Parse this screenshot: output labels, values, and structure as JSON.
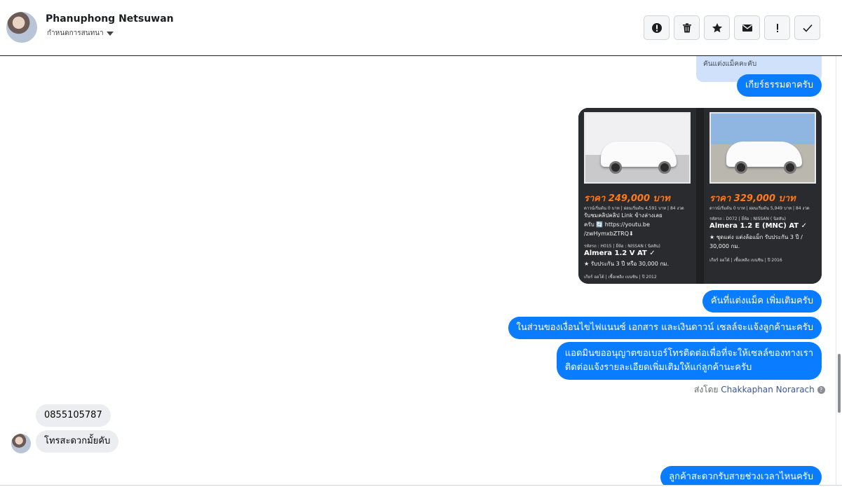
{
  "header": {
    "contact_name": "Phanuphong Netsuwan",
    "subtitle": "กำหนดการสนทนา"
  },
  "toolbar": {
    "buttons": [
      {
        "icon": "alert-circle-icon",
        "label": "Report"
      },
      {
        "icon": "trash-icon",
        "label": "Delete"
      },
      {
        "icon": "star-icon",
        "label": "Star"
      },
      {
        "icon": "envelope-icon",
        "label": "Mark unread"
      },
      {
        "icon": "exclamation-icon",
        "label": "Mark important"
      },
      {
        "icon": "check-icon",
        "label": "Done"
      }
    ]
  },
  "messages": {
    "quoted_reply": "คันแต่งแม็คคะคับ",
    "m1": "เกียร์ธรรมดาครับ",
    "m2": "คันที่แต่งแม็ค เพิ่มเติมครับ",
    "m3": "ในส่วนของเงื่อนไขไฟแนนซ์ เอกสาร และเงินดาวน์ เซลล์จะแจ้งลูกค้านะครับ",
    "m4_line1": "แอดมินขออนุญาตขอเบอร์โทรติดต่อเพื่อที่จะให้เซลล์ของทางเรา",
    "m4_line2": "ติดต่อแจ้งรายละเอียดเพิ่มเติมให้แก่ลูกค้านะครับ",
    "sent_by_prefix": "ส่งโดย",
    "sent_by_name": "Chakkaphan Norarach",
    "in1": "0855105787",
    "in2": "โทรสะดวกมั้ยคับ",
    "m5": "ลูกค้าสะดวกรับสายช่วงเวลาไหนครับ"
  },
  "car_card": {
    "left": {
      "price": "ราคา 249,000 บาท",
      "terms": "ดาวน์เริ่มต้น 0 บาท | ผ่อนเริ่มต้น 4,591 บาท | 84 งวด",
      "clip_line": "รับชมคลิปคลิป Link ข้างล่างเลย",
      "clip_line2": "ครับ 🔄 https://youtu.be",
      "clip_line3": "/zwHymxbZTRQ⬇",
      "code": "รหัสรถ : H015 | ยี่ห้อ : NISSAN ( นิสสัน)",
      "model": "Almera 1.2 V AT ✓",
      "warranty": "★ รับประกัน 3 ปี หรือ 30,000 กม.",
      "spec": "เกียร์ ออโต้ | เชื้อเพลิง เบนซิน | ปี 2012"
    },
    "right": {
      "price": "ราคา 329,000 บาท",
      "terms": "ดาวน์เริ่มต้น 0 บาท | ผ่อนเริ่มต้น 5,949 บาท | 84 งวด",
      "code": "รหัสรถ : D072 | ยี่ห้อ : NISSAN ( นิสสัน)",
      "model": "Almera 1.2 E (MNC) AT ✓",
      "warranty1": "★ ชุดแต่ง แต่งล้อแม็ก รับประกัน 3 ปี /",
      "warranty2": "30,000 กม.",
      "spec": "เกียร์ ออโต้ | เชื้อเพลิง เบนซิน | ปี 2016"
    }
  },
  "colors": {
    "outgoing_bubble": "#0a7cff",
    "incoming_bubble": "#ebedf0",
    "price_orange": "#ff7a1a"
  }
}
